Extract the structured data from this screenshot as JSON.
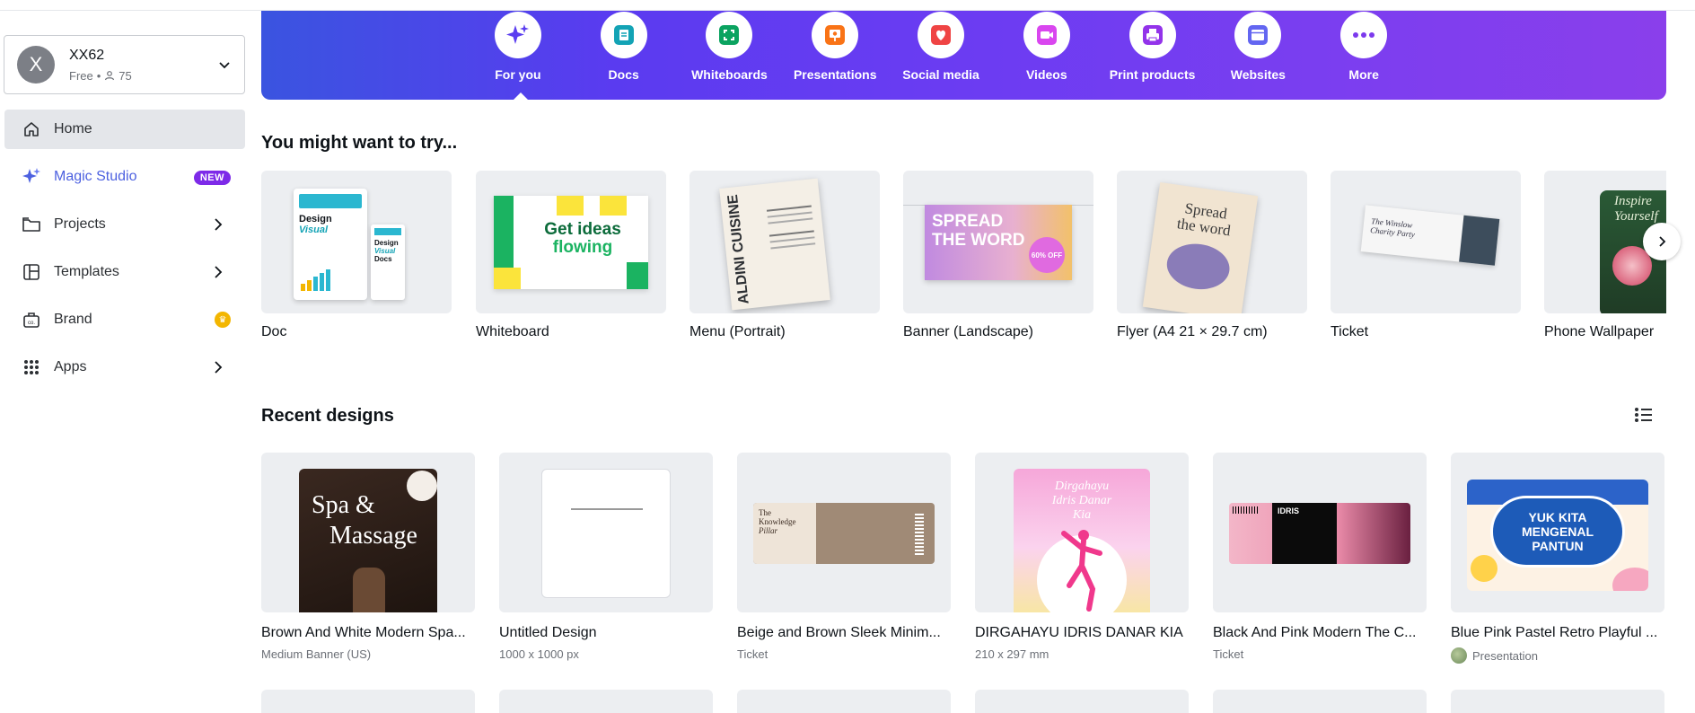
{
  "account": {
    "initial": "X",
    "name": "XX62",
    "plan": "Free",
    "members": "75"
  },
  "sidebar": {
    "items": [
      {
        "label": "Home",
        "icon": "home-icon"
      },
      {
        "label": "Magic Studio",
        "icon": "sparkle-icon",
        "badge": "NEW"
      },
      {
        "label": "Projects",
        "icon": "folder-icon"
      },
      {
        "label": "Templates",
        "icon": "templates-icon"
      },
      {
        "label": "Brand",
        "icon": "brand-icon"
      },
      {
        "label": "Apps",
        "icon": "apps-grid-icon"
      }
    ]
  },
  "categories": [
    {
      "label": "For you",
      "icon": "sparkle-icon",
      "color": "#5b3ef0"
    },
    {
      "label": "Docs",
      "icon": "doc-icon",
      "color": "#13a3b5"
    },
    {
      "label": "Whiteboards",
      "icon": "whiteboard-icon",
      "color": "#0ba360"
    },
    {
      "label": "Presentations",
      "icon": "presentation-icon",
      "color": "#f97316"
    },
    {
      "label": "Social media",
      "icon": "heart-icon",
      "color": "#ef4444"
    },
    {
      "label": "Videos",
      "icon": "video-icon",
      "color": "#d946ef"
    },
    {
      "label": "Print products",
      "icon": "printer-icon",
      "color": "#9333ea"
    },
    {
      "label": "Websites",
      "icon": "website-icon",
      "color": "#6366f1"
    },
    {
      "label": "More",
      "icon": "more-dots-icon",
      "color": "#7c3aed"
    }
  ],
  "try_section": {
    "title": "You might want to try...",
    "items": [
      {
        "label": "Doc",
        "thumb_title_1": "Design",
        "thumb_title_2": "Visual",
        "thumb_title_3": "Docs"
      },
      {
        "label": "Whiteboard",
        "thumb_title_1": "Get ideas",
        "thumb_title_2": "flowing"
      },
      {
        "label": "Menu (Portrait)",
        "thumb_title_1": "ALDINI",
        "thumb_title_2": "CUISINE"
      },
      {
        "label": "Banner (Landscape)",
        "thumb_title_1": "SPREAD",
        "thumb_title_2": "THE WORD",
        "thumb_badge": "60% OFF"
      },
      {
        "label": "Flyer (A4 21 × 29.7 cm)",
        "thumb_title_1": "Spread",
        "thumb_title_2": "the word"
      },
      {
        "label": "Ticket",
        "thumb_title_1": "The Winslow",
        "thumb_title_2": "Charity Party"
      },
      {
        "label": "Phone Wallpaper",
        "thumb_title_1": "Inspire",
        "thumb_title_2": "Yourself"
      }
    ]
  },
  "recent": {
    "title": "Recent designs",
    "items": [
      {
        "title": "Brown And White Modern Spa...",
        "sub": "Medium Banner (US)",
        "thumb_title_1": "Spa &",
        "thumb_title_2": "Massage"
      },
      {
        "title": "Untitled Design",
        "sub": "1000 x 1000 px"
      },
      {
        "title": "Beige and Brown Sleek Minim...",
        "sub": "Ticket",
        "thumb_title_1": "The",
        "thumb_title_2": "Knowledge",
        "thumb_title_3": "Pillar"
      },
      {
        "title": "DIRGAHAYU IDRIS DANAR KIA",
        "sub": "210 x 297 mm",
        "thumb_title_1": "Dirgahayu",
        "thumb_title_2": "Idris Danar",
        "thumb_title_3": "Kia"
      },
      {
        "title": "Black And Pink Modern The C...",
        "sub": "Ticket",
        "thumb_title_1": "IDRIS"
      },
      {
        "title": "Blue Pink Pastel Retro Playful ...",
        "sub": "Presentation",
        "thumb_title_1": "YUK KITA",
        "thumb_title_2": "MENGENAL",
        "thumb_title_3": "PANTUN"
      }
    ]
  }
}
